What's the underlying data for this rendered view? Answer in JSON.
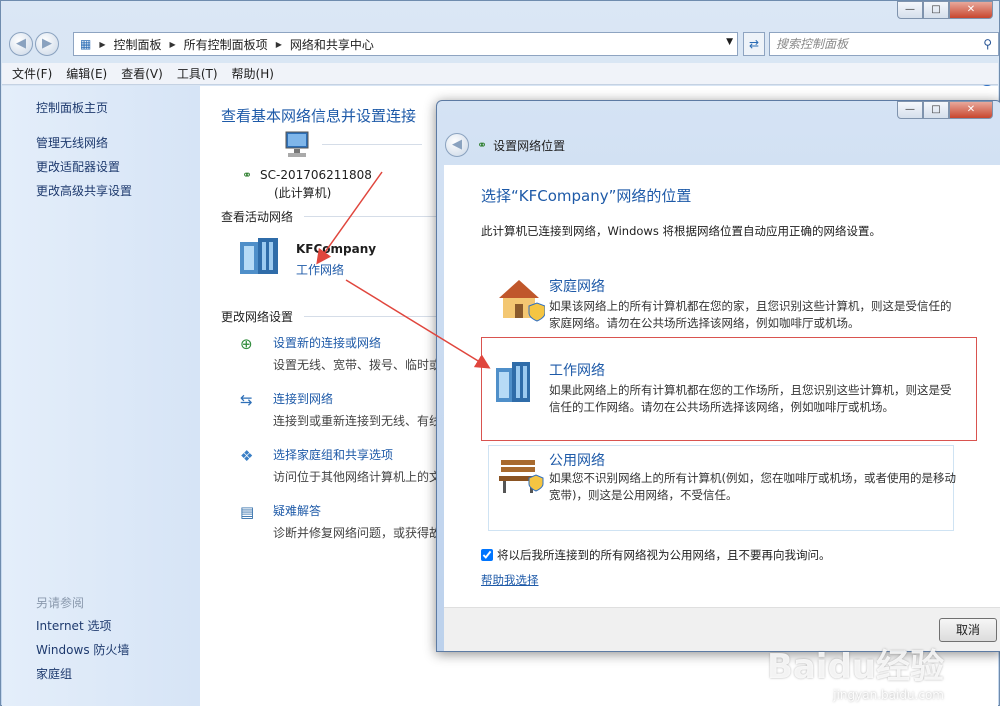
{
  "window": {
    "breadcrumb": [
      "控制面板",
      "所有控制面板项",
      "网络和共享中心"
    ],
    "search_placeholder": "搜索控制面板",
    "menu": [
      "文件(F)",
      "编辑(E)",
      "查看(V)",
      "工具(T)",
      "帮助(H)"
    ]
  },
  "sidebar": {
    "items": [
      "控制面板主页",
      "管理无线网络",
      "更改适配器设置",
      "更改高级共享设置"
    ],
    "see_also_title": "另请参阅",
    "see_also": [
      "Internet 选项",
      "Windows 防火墙",
      "家庭组"
    ]
  },
  "main": {
    "heading": "查看基本网络信息并设置连接",
    "computer_name": "SC-201706211808",
    "computer_sub": "(此计算机)",
    "active_section": "查看活动网络",
    "network_name": "KFCompany",
    "network_type_link": "工作网络",
    "change_section": "更改网络设置",
    "tasks": [
      {
        "title": "设置新的连接或网络",
        "desc": "设置无线、宽带、拨号、临时或"
      },
      {
        "title": "连接到网络",
        "desc": "连接到或重新连接到无线、有线、"
      },
      {
        "title": "选择家庭组和共享选项",
        "desc": "访问位于其他网络计算机上的文"
      },
      {
        "title": "疑难解答",
        "desc": "诊断并修复网络问题，或获得故"
      }
    ]
  },
  "dialog": {
    "title": "设置网络位置",
    "heading": "选择“KFCompany”网络的位置",
    "intro": "此计算机已连接到网络，Windows 将根据网络位置自动应用正确的网络设置。",
    "options": [
      {
        "title": "家庭网络",
        "desc": "如果该网络上的所有计算机都在您的家，且您识别这些计算机，则这是受信任的家庭网络。请勿在公共场所选择该网络，例如咖啡厅或机场。"
      },
      {
        "title": "工作网络",
        "desc": "如果此网络上的所有计算机都在您的工作场所，且您识别这些计算机，则这是受信任的工作网络。请勿在公共场所选择该网络，例如咖啡厅或机场。"
      },
      {
        "title": "公用网络",
        "desc": "如果您不识别网络上的所有计算机(例如，您在咖啡厅或机场，或者使用的是移动宽带)，则这是公用网络，不受信任。"
      }
    ],
    "checkbox_label": "将以后我所连接到的所有网络视为公用网络，且不要再向我询问。",
    "checkbox_checked": true,
    "help_link": "帮助我选择",
    "cancel": "取消"
  },
  "watermark": {
    "brand": "Baidu经验",
    "url": "jingyan.baidu.com"
  },
  "colors": {
    "accent": "#1e5aa8",
    "highlight_border": "#d9534f",
    "arrow": "#e0463d"
  }
}
